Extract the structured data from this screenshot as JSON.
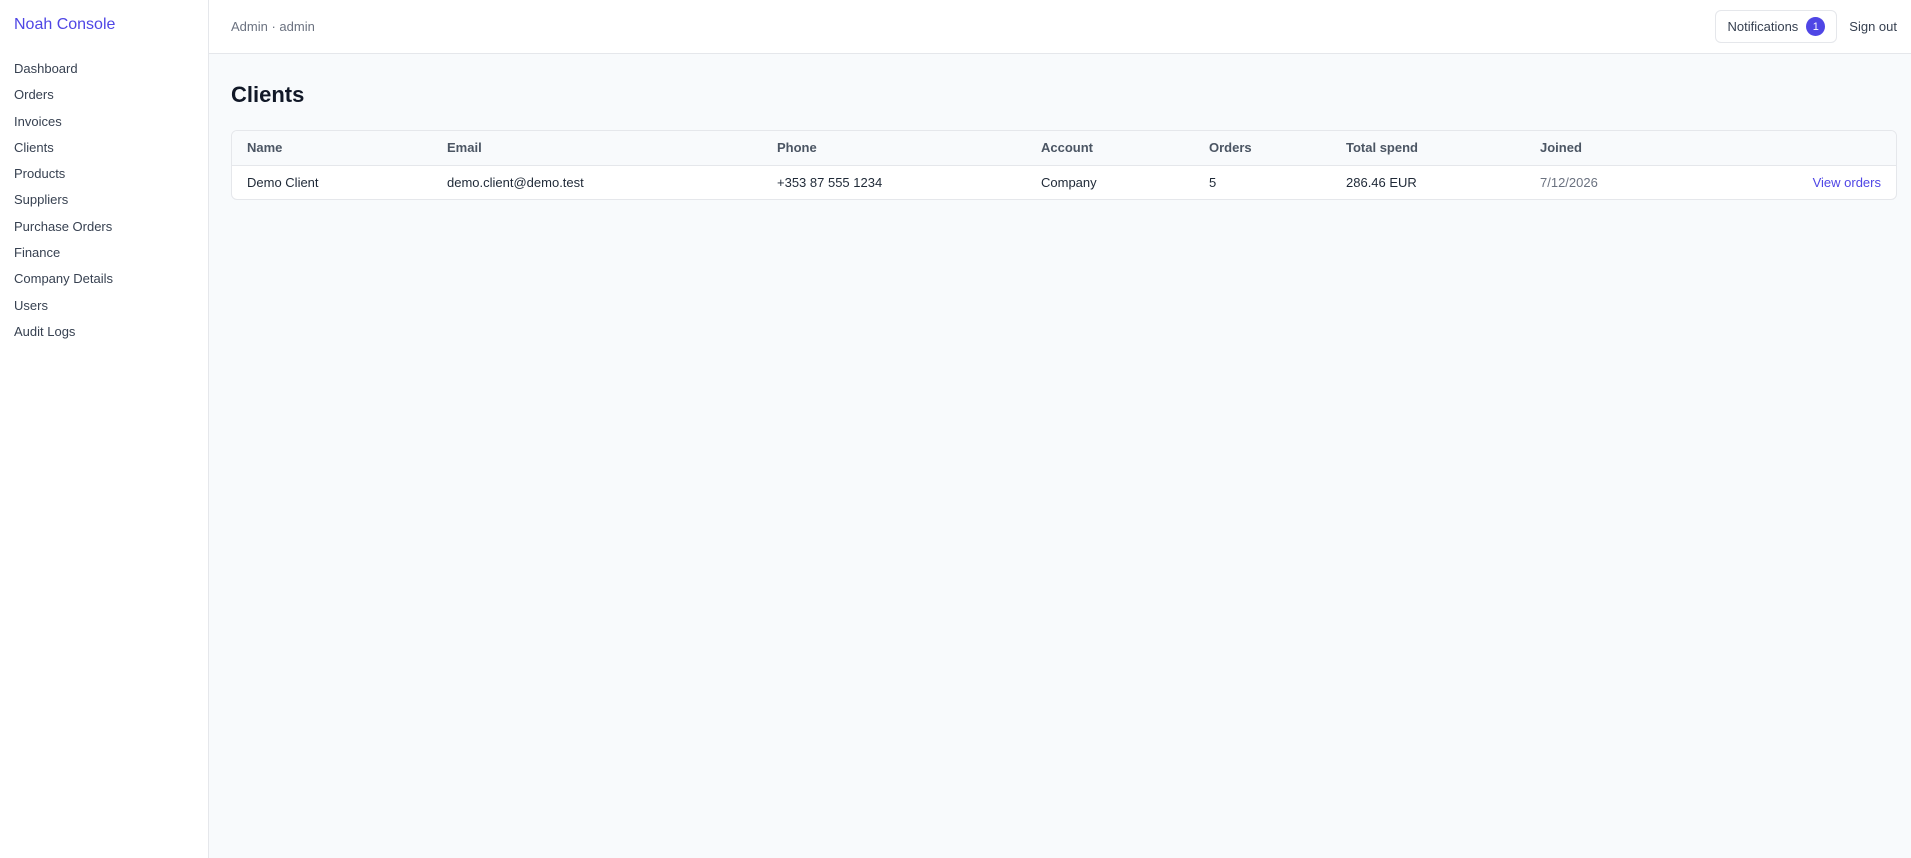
{
  "app": {
    "title": "Noah Console"
  },
  "sidebar": {
    "items": [
      {
        "label": "Dashboard"
      },
      {
        "label": "Orders"
      },
      {
        "label": "Invoices"
      },
      {
        "label": "Clients"
      },
      {
        "label": "Products"
      },
      {
        "label": "Suppliers"
      },
      {
        "label": "Purchase Orders"
      },
      {
        "label": "Finance"
      },
      {
        "label": "Company Details"
      },
      {
        "label": "Users"
      },
      {
        "label": "Audit Logs"
      }
    ]
  },
  "header": {
    "user": "Admin · admin",
    "notifications_label": "Notifications",
    "notifications_count": "1",
    "signout_label": "Sign out"
  },
  "page": {
    "title": "Clients"
  },
  "table": {
    "columns": [
      "Name",
      "Email",
      "Phone",
      "Account",
      "Orders",
      "Total spend",
      "Joined",
      ""
    ],
    "rows": [
      {
        "name": "Demo Client",
        "email": "demo.client@demo.test",
        "phone": "+353 87 555 1234",
        "account": "Company",
        "orders": "5",
        "total_spend": "286.46 EUR",
        "joined": "7/12/2026",
        "action": "View orders"
      }
    ]
  },
  "colors": {
    "accent": "#4f46e5",
    "background": "#f8fafc",
    "border": "#e5e7eb"
  }
}
